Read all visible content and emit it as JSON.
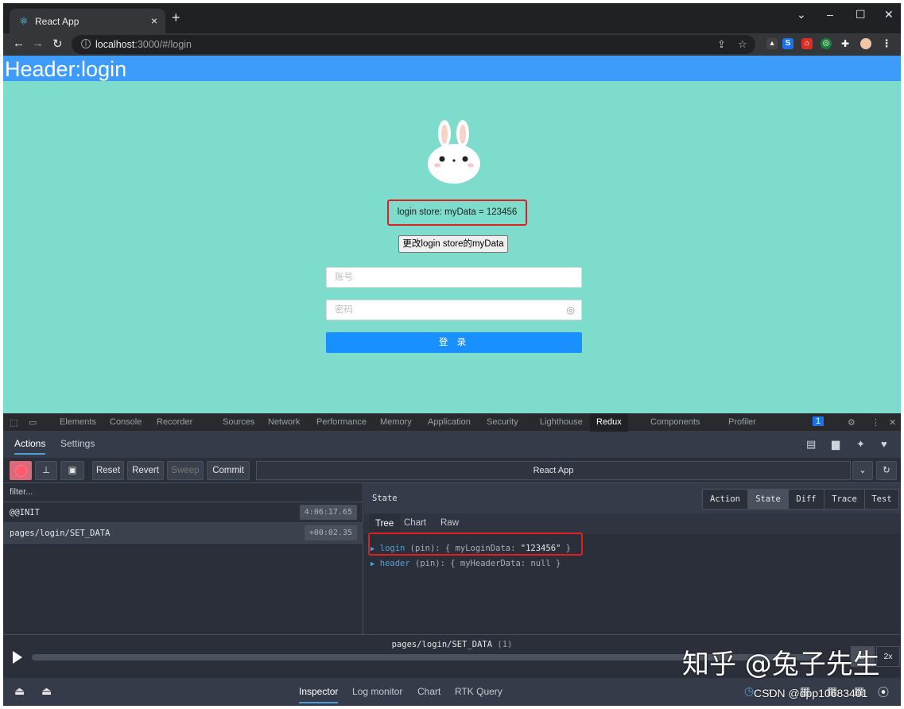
{
  "browser": {
    "tab_title": "React App",
    "tab_close": "×",
    "new_tab": "+",
    "url_host": "localhost",
    "url_rest": ":3000/#/login"
  },
  "page": {
    "header_title": "Header:login",
    "store_text": "login store: myData = 123456",
    "change_button": "更改login store的myData",
    "account_placeholder": "账号",
    "password_placeholder": "密码",
    "login_button": "登 录"
  },
  "devtools": {
    "tabs": [
      "Elements",
      "Console",
      "Recorder",
      "Sources",
      "Network",
      "Performance",
      "Memory",
      "Application",
      "Security",
      "Lighthouse",
      "Redux",
      "Components",
      "Profiler"
    ],
    "issues_count": "1"
  },
  "redux": {
    "top_tabs": [
      "Actions",
      "Settings"
    ],
    "toolbar": {
      "reset": "Reset",
      "revert": "Revert",
      "sweep": "Sweep",
      "commit": "Commit",
      "instance": "React App"
    },
    "filter_placeholder": "filter...",
    "actions": [
      {
        "name": "@@INIT",
        "time": "4:06:17.65"
      },
      {
        "name": "pages/login/SET_DATA",
        "time": "+00:02.35"
      }
    ],
    "state_label": "State",
    "modes": [
      "Action",
      "State",
      "Diff",
      "Trace",
      "Test"
    ],
    "sub_tabs": [
      "Tree",
      "Chart",
      "Raw"
    ],
    "tree": [
      {
        "key": "login",
        "pin": " (pin): { ",
        "field": "myLoginData: ",
        "value": "\"123456\"",
        "close": " }"
      },
      {
        "key": "header",
        "pin": " (pin): { ",
        "field": "myHeaderData: ",
        "value": "null",
        "close": " }"
      }
    ],
    "slider_action": "pages/login/SET_DATA",
    "slider_count": "(1)",
    "speeds": [
      "1x",
      "2x"
    ],
    "bottom_tabs": [
      "Inspector",
      "Log monitor",
      "Chart",
      "RTK Query"
    ]
  },
  "overlay": {
    "watermark": "知乎 @兔子先生",
    "csdn": "CSDN @dpp10683401"
  }
}
